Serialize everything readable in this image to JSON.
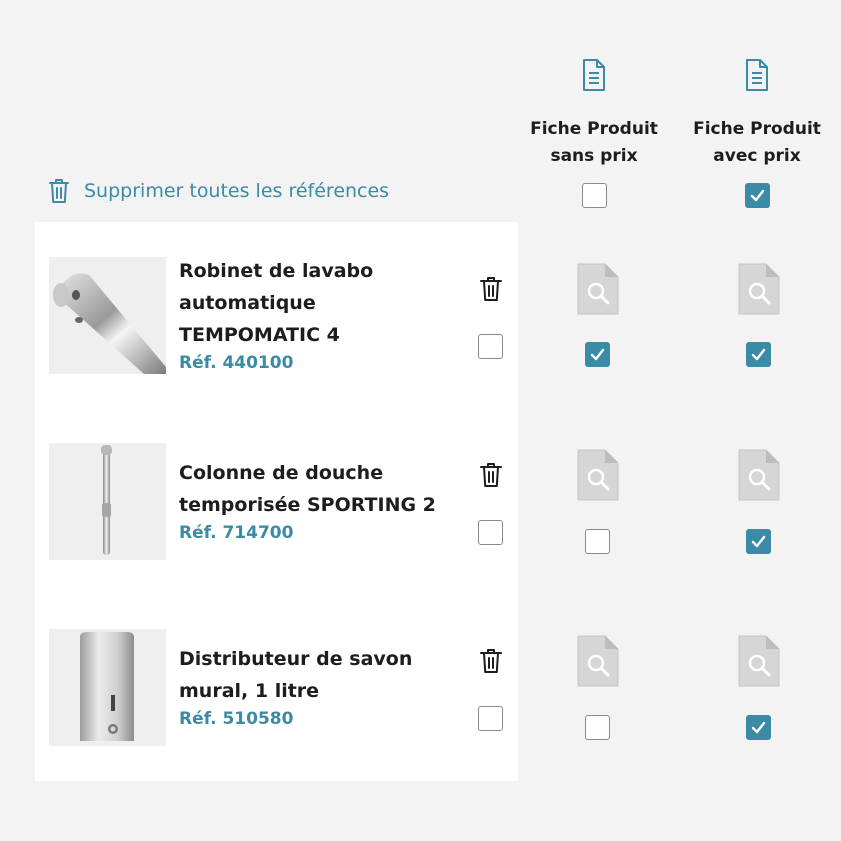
{
  "columns": [
    {
      "title_line1": "Fiche Produit",
      "title_line2": "sans prix",
      "icon": "document-icon",
      "select_all_checked": false
    },
    {
      "title_line1": "Fiche Produit",
      "title_line2": "avec prix",
      "icon": "document-icon",
      "select_all_checked": true
    }
  ],
  "delete_all": {
    "label": "Supprimer toutes les références",
    "icon": "trash-icon"
  },
  "products": [
    {
      "name": "Robinet de lavabo automatique TEMPOMATIC 4",
      "ref": "Réf. 440100",
      "selected": false,
      "sans_prix": true,
      "avec_prix": true
    },
    {
      "name": "Colonne de douche temporisée SPORTING 2",
      "ref": "Réf. 714700",
      "selected": false,
      "sans_prix": false,
      "avec_prix": true
    },
    {
      "name": "Distributeur de savon mural, 1 litre",
      "ref": "Réf. 510580",
      "selected": false,
      "sans_prix": false,
      "avec_prix": true
    }
  ],
  "colors": {
    "accent": "#3b8aa6",
    "background": "#f3f3f3",
    "panel": "#ffffff"
  }
}
